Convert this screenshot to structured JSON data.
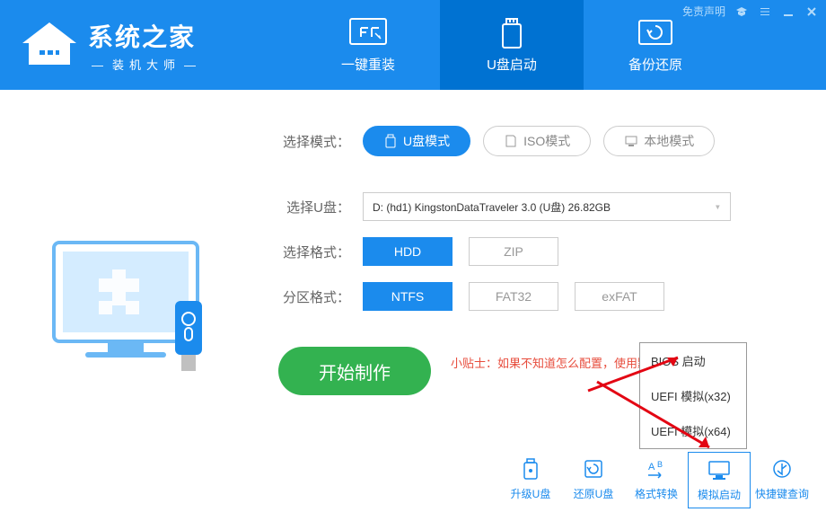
{
  "titlebar": {
    "disclaimer": "免责声明"
  },
  "logo": {
    "title": "系统之家",
    "subtitle": "装机大师"
  },
  "nav": {
    "reinstall": "一键重装",
    "usb_boot": "U盘启动",
    "backup": "备份还原"
  },
  "labels": {
    "select_mode": "选择模式：",
    "select_usb": "选择U盘：",
    "select_format": "选择格式：",
    "partition_format": "分区格式："
  },
  "modes": {
    "usb": "U盘模式",
    "iso": "ISO模式",
    "local": "本地模式"
  },
  "usb_device": "D: (hd1) KingstonDataTraveler 3.0 (U盘) 26.82GB",
  "formats": {
    "hdd": "HDD",
    "zip": "ZIP"
  },
  "partitions": {
    "ntfs": "NTFS",
    "fat32": "FAT32",
    "exfat": "exFAT"
  },
  "start_button": "开始制作",
  "tip_label": "小贴士：",
  "tip_text": "如果不知道怎么配置，使用默认配置即可",
  "popup": {
    "bios": "BIOS 启动",
    "uefi32": "UEFI 模拟(x32)",
    "uefi64": "UEFI 模拟(x64)"
  },
  "tools": {
    "upgrade": "升级U盘",
    "restore": "还原U盘",
    "convert": "格式转换",
    "simulate": "模拟启动",
    "shortcut": "快捷键查询"
  }
}
